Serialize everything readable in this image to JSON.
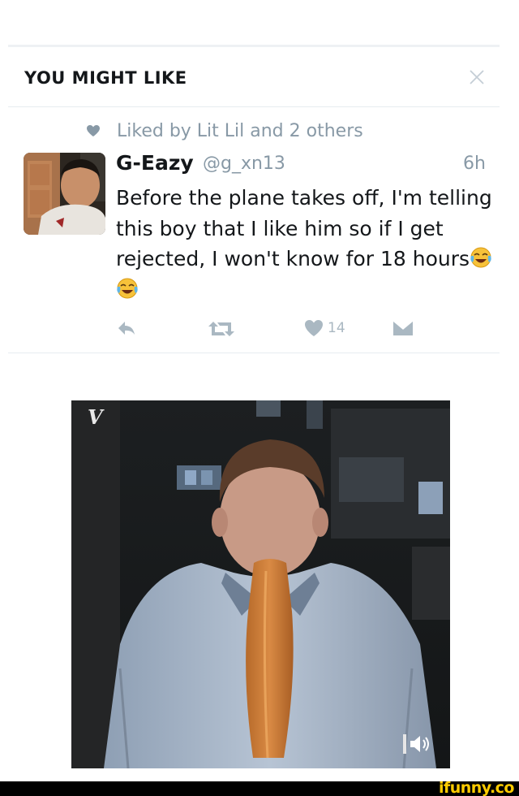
{
  "section": {
    "title": "YOU MIGHT LIKE"
  },
  "tweet": {
    "social_context": "Liked by Lit Lil and 2 others",
    "name": "G-Eazy",
    "handle": "@g_xn13",
    "time": "6h",
    "text": "Before the plane takes off, I'm telling this boy that I like him so if I get rejected, I won't know for 18 hours",
    "emojis": [
      "face-with-tears-of-joy",
      "face-with-tears-of-joy"
    ],
    "actions": {
      "like_count": "14"
    }
  },
  "media": {
    "type": "vine-video",
    "logo": "V"
  },
  "watermark": "ifunny.co",
  "colors": {
    "text": "#14171a",
    "secondary": "#8899a6",
    "icon": "#aab8c2",
    "watermark": "#ffcc00"
  }
}
